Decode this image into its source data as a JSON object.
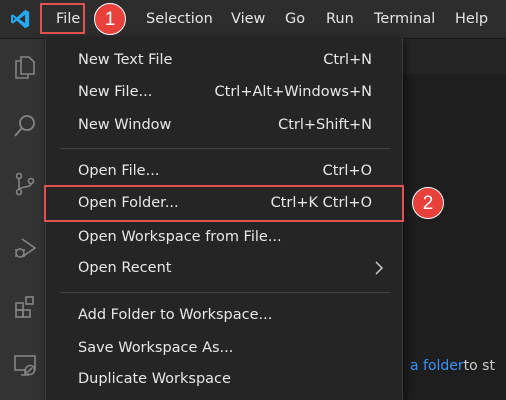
{
  "menubar": {
    "items": [
      "File",
      "Selection",
      "View",
      "Go",
      "Run",
      "Terminal",
      "Help"
    ]
  },
  "callouts": [
    "1",
    "2"
  ],
  "file_menu": {
    "items": [
      {
        "label": "New Text File",
        "shortcut": "Ctrl+N"
      },
      {
        "label": "New File...",
        "shortcut": "Ctrl+Alt+Windows+N"
      },
      {
        "label": "New Window",
        "shortcut": "Ctrl+Shift+N"
      },
      {
        "label": "Open File...",
        "shortcut": "Ctrl+O"
      },
      {
        "label": "Open Folder...",
        "shortcut": "Ctrl+K Ctrl+O"
      },
      {
        "label": "Open Workspace from File...",
        "shortcut": ""
      },
      {
        "label": "Open Recent",
        "shortcut": ""
      },
      {
        "label": "Add Folder to Workspace...",
        "shortcut": ""
      },
      {
        "label": "Save Workspace As...",
        "shortcut": ""
      },
      {
        "label": "Duplicate Workspace",
        "shortcut": ""
      }
    ]
  },
  "welcome": {
    "link": "a folder",
    "text_after": "to st"
  },
  "icons": {
    "logo": "vscode-logo-icon",
    "activity": [
      "explorer-icon",
      "search-icon",
      "source-control-icon",
      "run-debug-icon",
      "extensions-icon",
      "remote-explorer-icon"
    ],
    "submenu": "chevron-right-icon"
  },
  "colors": {
    "titlebar_bg": "#2d2d2d",
    "menu_bg": "#252526",
    "activitybar_bg": "#333333",
    "editor_bg": "#1e1e1e",
    "annotation_red": "#e0524f",
    "link_blue": "#3794ff",
    "logo_blue": "#23a9f2"
  }
}
